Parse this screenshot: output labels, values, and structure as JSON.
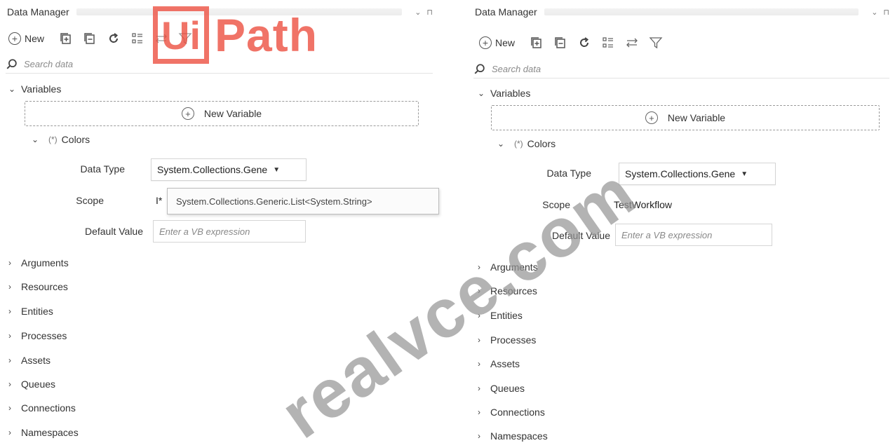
{
  "left": {
    "title": "Data Manager",
    "window_controls": [
      "⌄",
      "⊓"
    ],
    "toolbar": {
      "new_label": "New",
      "new_symbol": "+"
    },
    "search": {
      "placeholder": "Search data"
    },
    "variables_label": "Variables",
    "new_variable_label": "New Variable",
    "new_variable_symbol": "+",
    "colors_label": "Colors",
    "colors_marker": "(*)",
    "data_type_label": "Data Type",
    "data_type_value": "System.Collections.Gene",
    "scope_label": "Scope",
    "scope_value_partial": "I*",
    "tooltip_text": "System.Collections.Generic.List<System.String>",
    "default_value_label": "Default Value",
    "default_value_placeholder": "Enter a VB expression",
    "sections": [
      "Arguments",
      "Resources",
      "Entities",
      "Processes",
      "Assets",
      "Queues",
      "Connections",
      "Namespaces"
    ]
  },
  "right": {
    "title": "Data Manager",
    "window_controls": [
      "⌄",
      "⊓"
    ],
    "toolbar": {
      "new_label": "New",
      "new_symbol": "+"
    },
    "search": {
      "placeholder": "Search data"
    },
    "variables_label": "Variables",
    "new_variable_label": "New Variable",
    "new_variable_symbol": "+",
    "colors_label": "Colors",
    "colors_marker": "(*)",
    "data_type_label": "Data Type",
    "data_type_value": "System.Collections.Gene",
    "scope_label": "Scope",
    "scope_value": "TestWorkflow",
    "default_value_label": "Default Value",
    "default_value_placeholder": "Enter a VB expression",
    "sections": [
      "Arguments",
      "Resources",
      "Entities",
      "Processes",
      "Assets",
      "Queues",
      "Connections",
      "Namespaces"
    ]
  },
  "watermarks": {
    "logo_box": "Ui",
    "logo_text": "Path",
    "diagonal": "realvce.com"
  },
  "colors": {
    "brand": "#ee5b4d",
    "dashed_border": "#9a9a9a",
    "text": "#333333"
  },
  "icons": [
    "new-circle-plus-icon",
    "expand-all-icon",
    "collapse-all-icon",
    "refresh-icon",
    "list-view-icon",
    "sort-icon",
    "filter-icon",
    "search-icon",
    "chevron-icon",
    "caret-down-icon"
  ]
}
